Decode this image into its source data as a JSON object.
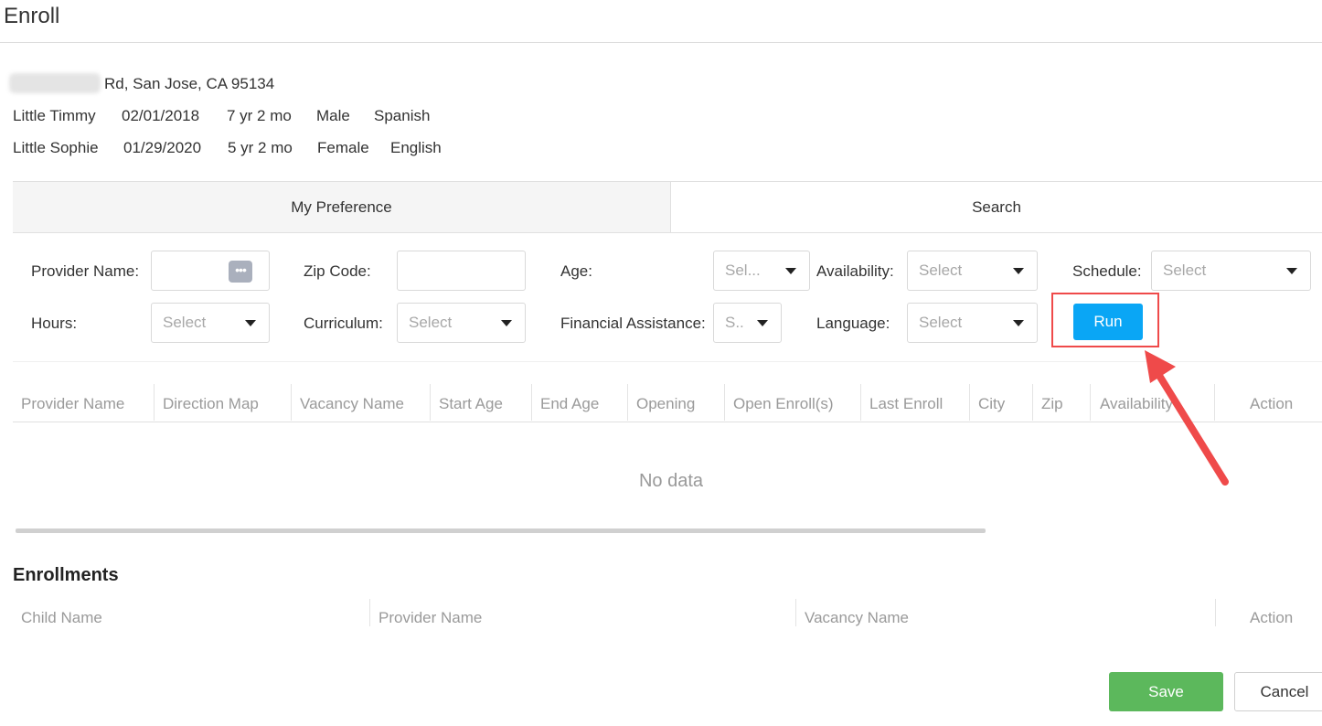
{
  "page": {
    "title": "Enroll"
  },
  "family": {
    "address_suffix": "Rd, San Jose, CA 95134",
    "children": [
      {
        "name": "Little Timmy",
        "dob": "02/01/2018",
        "age": "7 yr 2 mo",
        "gender": "Male",
        "language": "Spanish"
      },
      {
        "name": "Little Sophie",
        "dob": "01/29/2020",
        "age": "5 yr 2 mo",
        "gender": "Female",
        "language": "English"
      }
    ]
  },
  "tabs": [
    {
      "label": "My Preference",
      "active": true
    },
    {
      "label": "Search",
      "active": false
    }
  ],
  "filters": {
    "provider_name": {
      "label": "Provider Name:",
      "value": "",
      "lookup_icon": "ellipsis-icon"
    },
    "zip_code": {
      "label": "Zip Code:",
      "value": ""
    },
    "age": {
      "label": "Age:",
      "value": "Sel..."
    },
    "availability": {
      "label": "Availability:",
      "value": "Select"
    },
    "schedule": {
      "label": "Schedule:",
      "value": "Select"
    },
    "hours": {
      "label": "Hours:",
      "value": "Select"
    },
    "curriculum": {
      "label": "Curriculum:",
      "value": "Select"
    },
    "financial_assistance": {
      "label": "Financial Assistance:",
      "value": "S.."
    },
    "language": {
      "label": "Language:",
      "value": "Select"
    },
    "run_label": "Run"
  },
  "results_table": {
    "columns": [
      "Provider Name",
      "Direction Map",
      "Vacancy Name",
      "Start Age",
      "End Age",
      "Opening",
      "Open Enroll(s)",
      "Last Enroll",
      "City",
      "Zip",
      "Availability",
      "Action"
    ],
    "empty_text": "No data"
  },
  "enrollments": {
    "title": "Enrollments",
    "columns": [
      "Child Name",
      "Provider Name",
      "Vacancy Name",
      "Action"
    ]
  },
  "footer": {
    "save_label": "Save",
    "cancel_label": "Cancel"
  },
  "colors": {
    "primary": "#0aa6f5",
    "success": "#5cb85c",
    "highlight": "#ef4a4a"
  }
}
